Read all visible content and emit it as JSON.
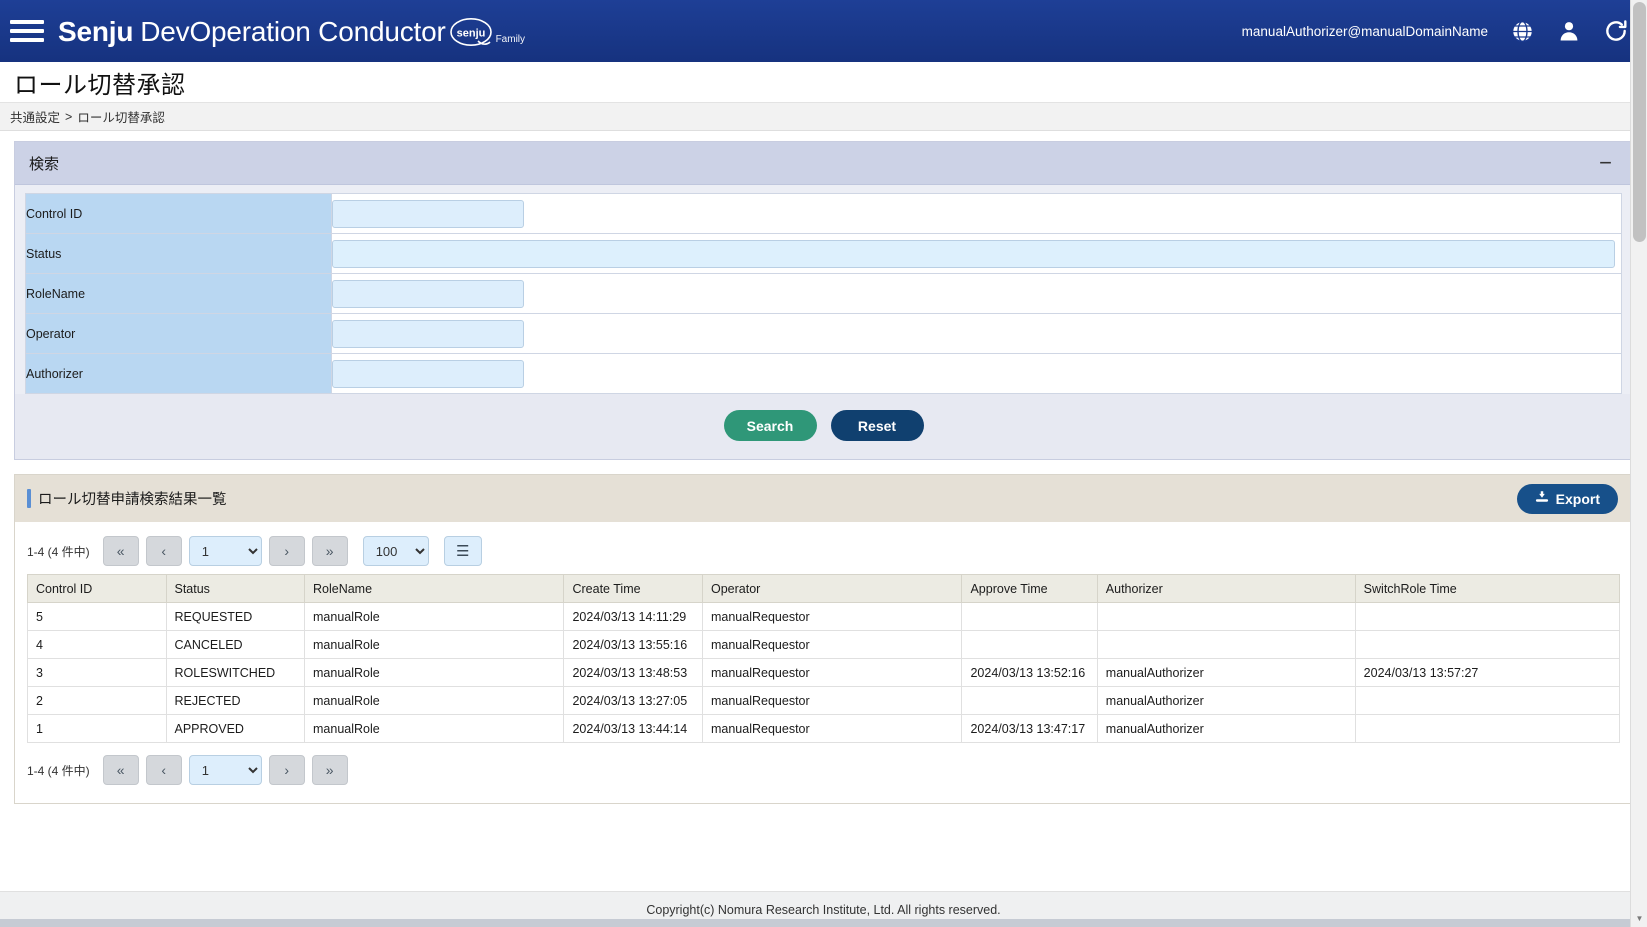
{
  "navbar": {
    "menu_icon": "hamburger-icon",
    "brand_bold": "Senju",
    "brand_rest": "DevOperation Conductor",
    "brand_badge": "senju",
    "brand_family": "Family",
    "user": "manualAuthorizer@manualDomainName",
    "globe_icon": "globe-icon",
    "user_icon": "user-icon",
    "reload_icon": "reload-icon"
  },
  "page": {
    "title": "ロール切替承認"
  },
  "breadcrumb": {
    "parent": "共通設定",
    "separator": ">",
    "current": "ロール切替承認"
  },
  "search_panel": {
    "title": "検索",
    "collapse_icon": "minus-icon",
    "fields": [
      {
        "label": "Control ID",
        "value": "",
        "placeholder": "",
        "wide": false
      },
      {
        "label": "Status",
        "value": "",
        "placeholder": "",
        "wide": true
      },
      {
        "label": "RoleName",
        "value": "",
        "placeholder": "",
        "wide": false
      },
      {
        "label": "Operator",
        "value": "",
        "placeholder": "",
        "wide": false
      },
      {
        "label": "Authorizer",
        "value": "",
        "placeholder": "",
        "wide": false
      }
    ],
    "search_label": "Search",
    "reset_label": "Reset"
  },
  "results": {
    "title": "ロール切替申請検索結果一覧",
    "export_label": "Export",
    "export_icon": "download-icon",
    "pager": {
      "count_label": "1-4 (4 件中)",
      "first_icon": "«",
      "prev_icon": "‹",
      "next_icon": "›",
      "last_icon": "»",
      "page_value": "1",
      "page_options": [
        "1"
      ],
      "size_value": "100",
      "size_options": [
        "100"
      ],
      "menu_icon": "☰"
    },
    "columns": [
      "Control ID",
      "Status",
      "RoleName",
      "Create Time",
      "Operator",
      "Approve Time",
      "Authorizer",
      "SwitchRole Time"
    ],
    "rows": [
      {
        "control_id": "5",
        "status": "REQUESTED",
        "role_name": "manualRole",
        "create_time": "2024/03/13 14:11:29",
        "operator": "manualRequestor",
        "approve_time": "",
        "authorizer": "",
        "switchrole_time": ""
      },
      {
        "control_id": "4",
        "status": "CANCELED",
        "role_name": "manualRole",
        "create_time": "2024/03/13 13:55:16",
        "operator": "manualRequestor",
        "approve_time": "",
        "authorizer": "",
        "switchrole_time": ""
      },
      {
        "control_id": "3",
        "status": "ROLESWITCHED",
        "role_name": "manualRole",
        "create_time": "2024/03/13 13:48:53",
        "operator": "manualRequestor",
        "approve_time": "2024/03/13 13:52:16",
        "authorizer": "manualAuthorizer",
        "switchrole_time": "2024/03/13 13:57:27"
      },
      {
        "control_id": "2",
        "status": "REJECTED",
        "role_name": "manualRole",
        "create_time": "2024/03/13 13:27:05",
        "operator": "manualRequestor",
        "approve_time": "",
        "authorizer": "manualAuthorizer",
        "switchrole_time": ""
      },
      {
        "control_id": "1",
        "status": "APPROVED",
        "role_name": "manualRole",
        "create_time": "2024/03/13 13:44:14",
        "operator": "manualRequestor",
        "approve_time": "2024/03/13 13:47:17",
        "authorizer": "manualAuthorizer",
        "switchrole_time": ""
      }
    ]
  },
  "footer": {
    "copyright": "Copyright(c) Nomura Research Institute, Ltd. All rights reserved."
  },
  "colors": {
    "navbar": "#1a3a8f",
    "search_button": "#2f9778",
    "reset_button": "#10406f",
    "export_button": "#17508a",
    "panel_header": "#ccd2e6",
    "field_label": "#b9d7f2",
    "results_header": "#e5e0d6"
  }
}
